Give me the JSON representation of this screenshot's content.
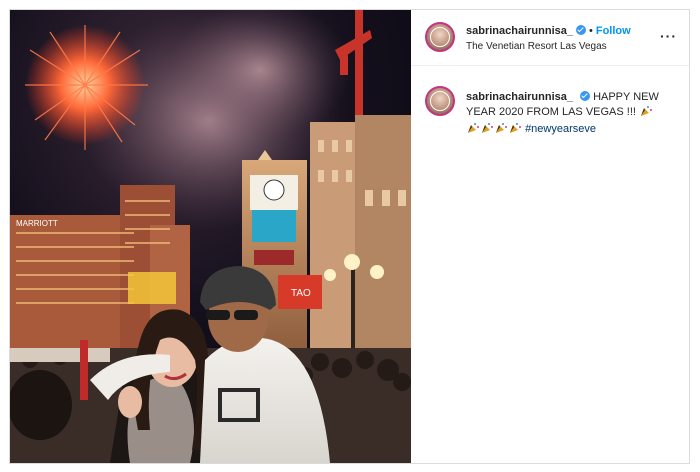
{
  "post": {
    "username": "sabrinachairunnisa_",
    "follow_label": "Follow",
    "separator": "•",
    "location": "The Venetian Resort Las Vegas",
    "more_label": "···",
    "caption_text": "HAPPY NEW YEAR 2020 FROM LAS VEGAS !!!",
    "hashtag": "#newyearseve",
    "caption_emoji": [
      "party-popper-icon",
      "party-popper-icon",
      "party-popper-icon",
      "party-popper-icon",
      "party-popper-icon"
    ]
  },
  "photo": {
    "signs": {
      "hotel": "MARRIOTT",
      "billboard": "TAO"
    }
  },
  "colors": {
    "link_blue": "#0095f6",
    "verified_blue": "#3897f0",
    "hashtag_blue": "#00376b",
    "text": "#262626",
    "border": "#dbdbdb"
  }
}
